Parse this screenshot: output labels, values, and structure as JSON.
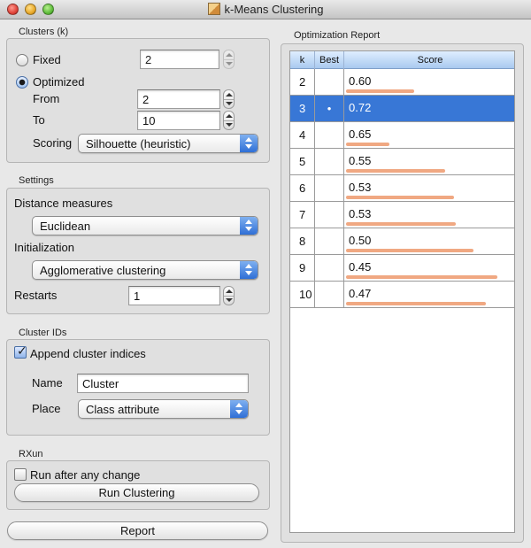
{
  "window": {
    "title": "k-Means Clustering"
  },
  "clusters": {
    "title": "Clusters (k)",
    "fixed_label": "Fixed",
    "fixed_value": "2",
    "optimized_label": "Optimized",
    "from_label": "From",
    "from_value": "2",
    "to_label": "To",
    "to_value": "10",
    "scoring_label": "Scoring",
    "scoring_value": "Silhouette (heuristic)"
  },
  "settings": {
    "title": "Settings",
    "distance_label": "Distance measures",
    "distance_value": "Euclidean",
    "init_label": "Initialization",
    "init_value": "Agglomerative clustering",
    "restarts_label": "Restarts",
    "restarts_value": "1"
  },
  "cluster_ids": {
    "title": "Cluster IDs",
    "append_label": "Append cluster indices",
    "name_label": "Name",
    "name_value": "Cluster",
    "place_label": "Place",
    "place_value": "Class attribute"
  },
  "run": {
    "title": "RXun",
    "auto_label": "Run after any change",
    "button_label": "Run Clustering"
  },
  "report_button": "Report",
  "report": {
    "title": "Optimization Report",
    "headers": {
      "k": "k",
      "best": "Best",
      "score": "Score"
    },
    "rows": [
      {
        "k": "2",
        "best": "",
        "score": "0.60",
        "bar": 0.43,
        "selected": false
      },
      {
        "k": "3",
        "best": "•",
        "score": "0.72",
        "bar": 0.0,
        "selected": true
      },
      {
        "k": "4",
        "best": "",
        "score": "0.65",
        "bar": 0.27,
        "selected": false
      },
      {
        "k": "5",
        "best": "",
        "score": "0.55",
        "bar": 0.62,
        "selected": false
      },
      {
        "k": "6",
        "best": "",
        "score": "0.53",
        "bar": 0.68,
        "selected": false
      },
      {
        "k": "7",
        "best": "",
        "score": "0.53",
        "bar": 0.69,
        "selected": false
      },
      {
        "k": "8",
        "best": "",
        "score": "0.50",
        "bar": 0.8,
        "selected": false
      },
      {
        "k": "9",
        "best": "",
        "score": "0.45",
        "bar": 0.95,
        "selected": false
      },
      {
        "k": "10",
        "best": "",
        "score": "0.47",
        "bar": 0.88,
        "selected": false
      }
    ]
  },
  "colors": {
    "selection": "#3877d6",
    "score_bar": "#f0a882",
    "popup_accent": "#2f6fd6"
  }
}
